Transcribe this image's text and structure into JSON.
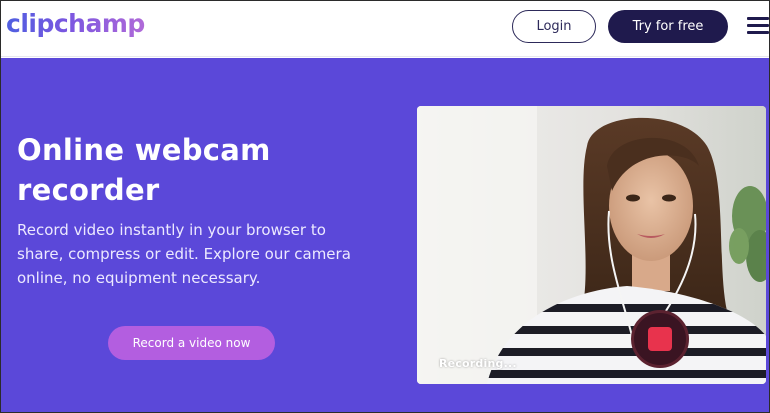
{
  "header": {
    "logo_text": "clipchamp",
    "login_label": "Login",
    "try_label": "Try for free",
    "menu_icon": "hamburger-menu-icon"
  },
  "hero": {
    "title": "Online webcam recorder",
    "description": "Record video instantly in your browser to share, compress or edit. Explore our camera online, no equipment necessary.",
    "cta_label": "Record a video now"
  },
  "video": {
    "status_text": "Recording...",
    "stop_icon": "stop-record-icon"
  },
  "colors": {
    "hero_background": "#5b48d9",
    "primary_dark": "#1f1a4d",
    "cta_purple": "#b35ee0",
    "record_red": "#e8334d",
    "logo_gradient_start": "#4f5fe0",
    "logo_gradient_end": "#b06ad8"
  }
}
